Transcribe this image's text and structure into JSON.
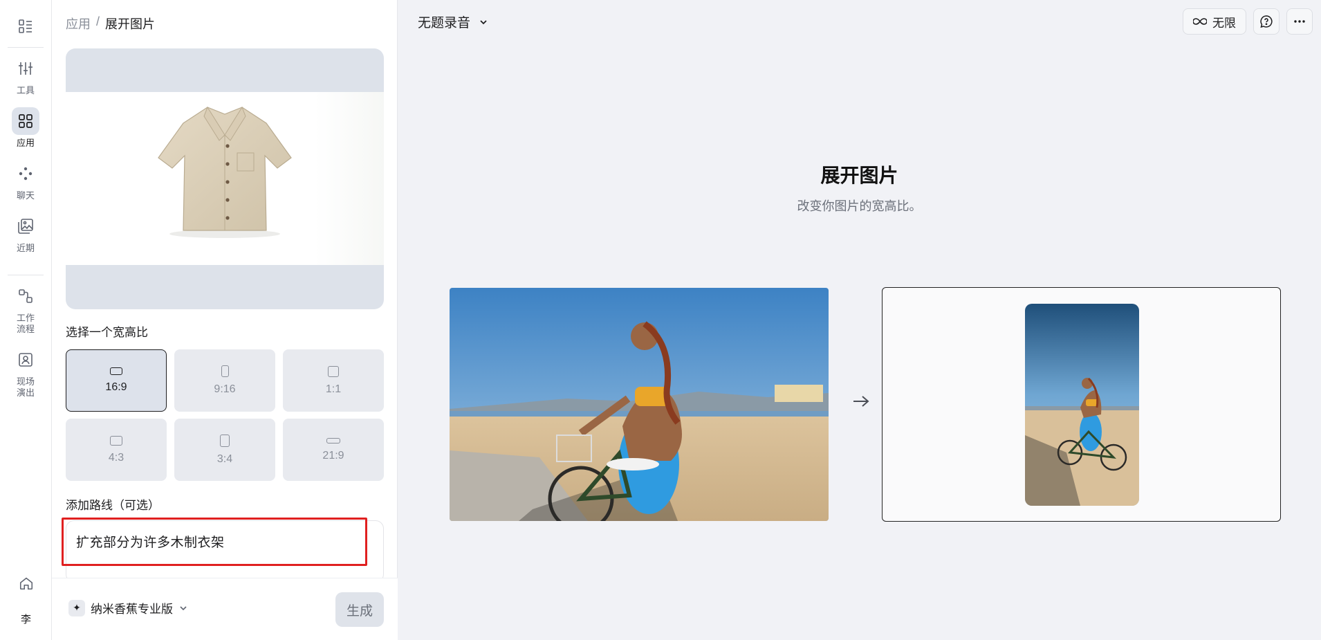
{
  "rail": {
    "items": [
      {
        "label": "工具",
        "icon": "sliders-icon"
      },
      {
        "label": "应用",
        "icon": "apps-grid-icon"
      },
      {
        "label": "聊天",
        "icon": "chat-dots-icon"
      },
      {
        "label": "近期",
        "icon": "gallery-icon"
      },
      {
        "label": "工作\n流程",
        "icon": "workflow-icon"
      },
      {
        "label": "现场\n演出",
        "icon": "live-show-icon"
      }
    ],
    "user_initial": "李"
  },
  "breadcrumb": {
    "root": "应用",
    "separator": "/",
    "current": "展开图片"
  },
  "aspect": {
    "label": "选择一个宽高比",
    "options": [
      {
        "label": "16:9",
        "selected": true
      },
      {
        "label": "9:16",
        "selected": false
      },
      {
        "label": "1:1",
        "selected": false
      },
      {
        "label": "4:3",
        "selected": false
      },
      {
        "label": "3:4",
        "selected": false
      },
      {
        "label": "21:9",
        "selected": false
      }
    ]
  },
  "prompt": {
    "label": "添加路线（可选）",
    "value": "扩充部分为许多木制衣架"
  },
  "footer": {
    "model": "纳米香蕉专业版",
    "generate": "生成"
  },
  "main": {
    "doc_title": "无题录音",
    "unlimited": "无限",
    "hero_title": "展开图片",
    "hero_subtitle": "改变你图片的宽高比。"
  },
  "colors": {
    "accent_red": "#e02020",
    "selected_bg": "#dde2eb"
  }
}
